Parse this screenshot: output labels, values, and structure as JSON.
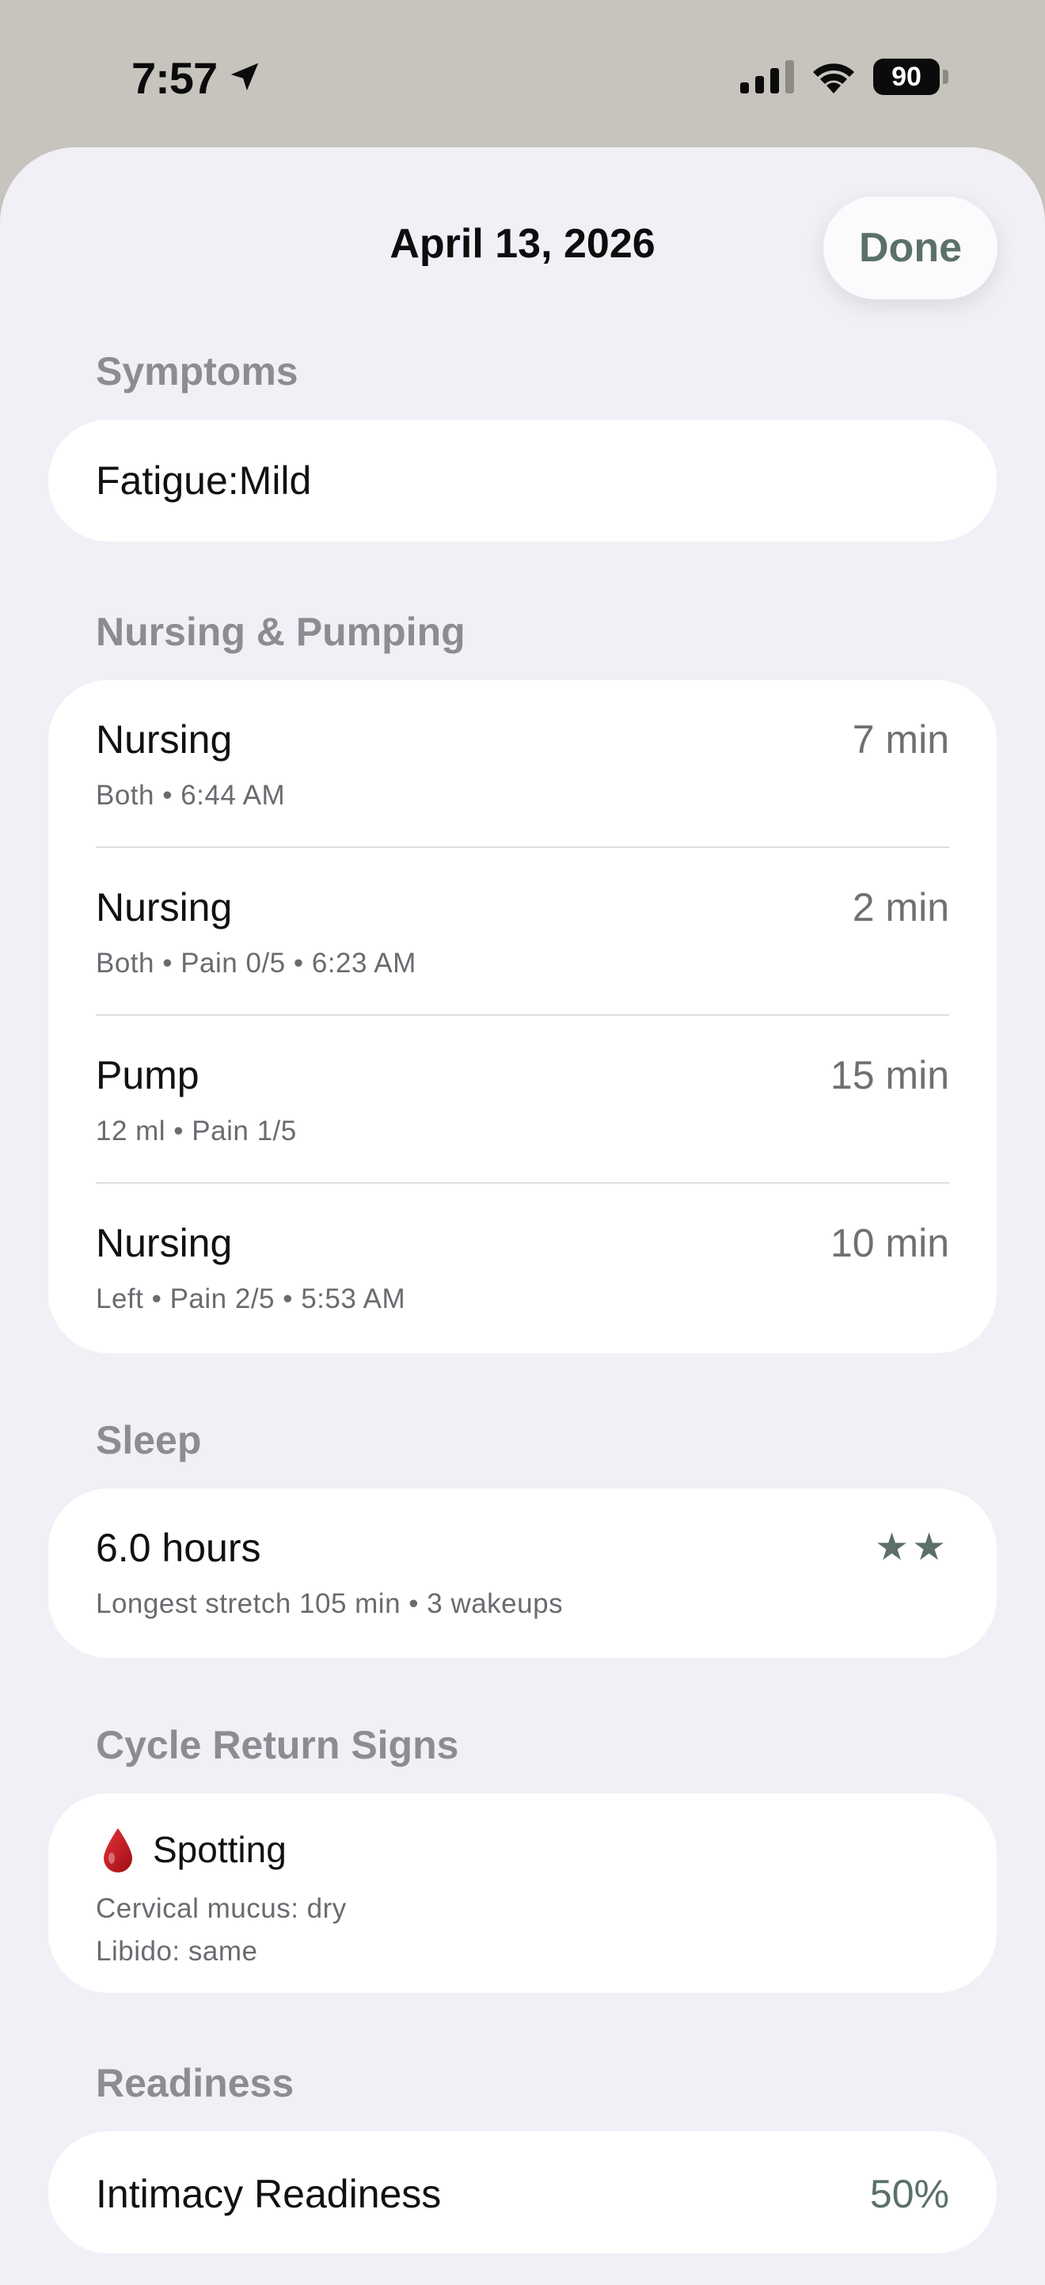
{
  "status_bar": {
    "time": "7:57",
    "battery": "90",
    "icons": [
      "location-arrow-icon",
      "cellular-signal-icon",
      "wifi-icon",
      "battery-icon"
    ]
  },
  "sheet": {
    "title": "April 13, 2026",
    "done_label": "Done"
  },
  "sections": {
    "symptoms": {
      "header": "Symptoms",
      "items": [
        {
          "title": "Fatigue:Mild"
        }
      ]
    },
    "nursing": {
      "header": "Nursing & Pumping",
      "items": [
        {
          "title": "Nursing",
          "subtitle": "Both • 6:44 AM",
          "value": "7 min"
        },
        {
          "title": "Nursing",
          "subtitle": "Both • Pain 0/5 • 6:23 AM",
          "value": "2 min"
        },
        {
          "title": "Pump",
          "subtitle": "12 ml • Pain 1/5",
          "value": "15 min"
        },
        {
          "title": "Nursing",
          "subtitle": "Left • Pain 2/5 • 5:53 AM",
          "value": "10 min"
        }
      ]
    },
    "sleep": {
      "header": "Sleep",
      "title": "6.0 hours",
      "subtitle": "Longest stretch 105 min • 3 wakeups",
      "rating_stars": "★★",
      "rating": 2
    },
    "cycle": {
      "header": "Cycle Return Signs",
      "title": "Spotting",
      "icon": "blood-drop-icon",
      "lines": [
        "Cervical mucus: dry",
        "Libido: same"
      ]
    },
    "readiness": {
      "header": "Readiness",
      "title": "Intimacy Readiness",
      "value": "50%"
    }
  },
  "colors": {
    "sheet_background": "#f1f0f6",
    "card_background": "#ffffff",
    "accent": "#5b706b",
    "section_header": "#8d8c93",
    "status_background": "#c7c4bd",
    "drop_red": "#c8161d"
  }
}
